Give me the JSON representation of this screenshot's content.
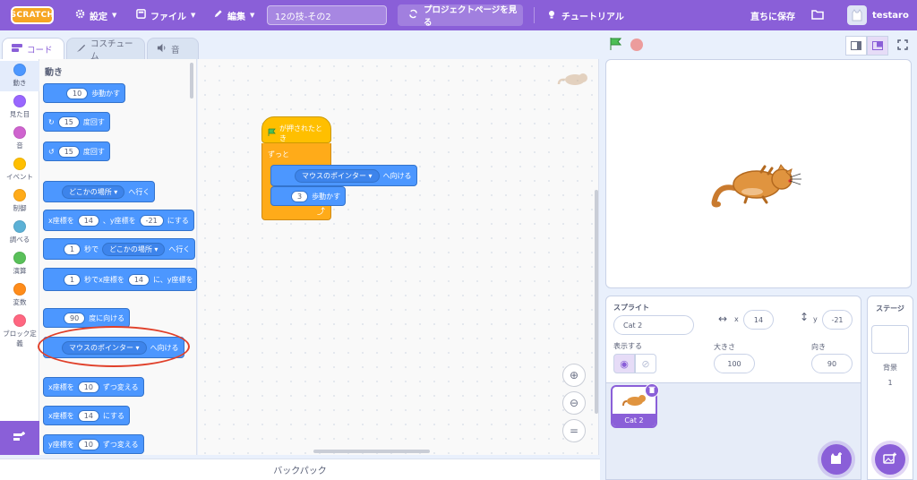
{
  "menubar": {
    "logo": "SCRATCH",
    "settings": "設定",
    "file": "ファイル",
    "edit": "編集",
    "project_title": "12の技-その2",
    "see_project_page": "プロジェクトページを見る",
    "tutorials": "チュートリアル",
    "save_now": "直ちに保存",
    "username": "testaro"
  },
  "tabs": {
    "code": "コード",
    "costumes": "コスチューム",
    "sounds": "音"
  },
  "categories": [
    {
      "label": "動き",
      "color": "#4c97ff"
    },
    {
      "label": "見た目",
      "color": "#9966ff"
    },
    {
      "label": "音",
      "color": "#cf63cf"
    },
    {
      "label": "イベント",
      "color": "#ffbf00"
    },
    {
      "label": "制御",
      "color": "#ffab19"
    },
    {
      "label": "調べる",
      "color": "#5cb1d6"
    },
    {
      "label": "演算",
      "color": "#59c059"
    },
    {
      "label": "変数",
      "color": "#ff8c1a"
    },
    {
      "label": "ブロック定義",
      "color": "#ff6680"
    }
  ],
  "palette": {
    "title": "動き",
    "move": {
      "value": "10",
      "label": "歩動かす"
    },
    "turn_right": {
      "value": "15",
      "label": "度回す"
    },
    "turn_left": {
      "value": "15",
      "label": "度回す"
    },
    "goto": {
      "dropdown": "どこかの場所",
      "label": "へ行く"
    },
    "goto_xy": {
      "x_label": "x座標を",
      "x": "14",
      "y_label": "、y座標を",
      "y": "-21",
      "suffix": "にする"
    },
    "glide": {
      "secs": "1",
      "secs_label": "秒で",
      "dropdown": "どこかの場所",
      "label": "へ行く"
    },
    "glide_xy": {
      "secs": "1",
      "secs_label": "秒でx座標を",
      "x": "14",
      "y_label": "に、y座標を"
    },
    "point_dir": {
      "value": "90",
      "label": "度に向ける"
    },
    "point_towards": {
      "dropdown": "マウスのポインター",
      "label": "へ向ける"
    },
    "change_x": {
      "prefix": "x座標を",
      "value": "10",
      "label": "ずつ変える"
    },
    "set_x": {
      "prefix": "x座標を",
      "value": "14",
      "label": "にする"
    },
    "change_y": {
      "prefix": "y座標を",
      "value": "10",
      "label": "ずつ変える"
    }
  },
  "script": {
    "hat": "が押されたとき",
    "forever": "ずっと",
    "point_towards": {
      "dropdown": "マウスのポインター",
      "label": "へ向ける"
    },
    "move": {
      "value": "3",
      "label": "歩動かす"
    }
  },
  "backpack": "バックパック",
  "sprite_info": {
    "sprite_label": "スプライト",
    "sprite_name": "Cat 2",
    "x_label": "x",
    "x": "14",
    "y_label": "y",
    "y": "-21",
    "show_label": "表示する",
    "size_label": "大きさ",
    "size": "100",
    "direction_label": "向き",
    "direction": "90"
  },
  "sprite_thumb": {
    "name": "Cat 2"
  },
  "stage_pane": {
    "title": "ステージ",
    "backdrops_label": "背景",
    "backdrops_count": "1"
  },
  "colors": {
    "accent": "#8a5fd8",
    "motion": "#4c97ff",
    "events": "#ffbf00",
    "control": "#ffab19",
    "highlight": "#e0402a"
  }
}
